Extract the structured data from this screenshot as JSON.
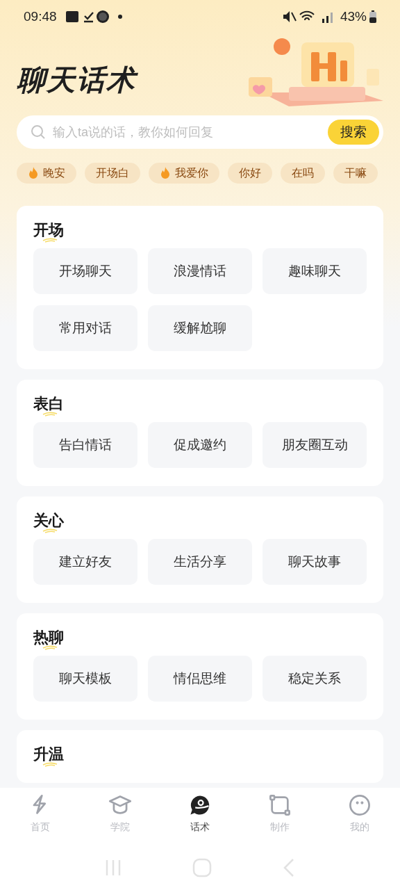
{
  "status_bar": {
    "time": "09:48",
    "battery": "43%"
  },
  "title": "聊天话术",
  "search": {
    "placeholder": "输入ta说的话，教你如何回复",
    "button": "搜索"
  },
  "chips": [
    {
      "label": "晚安",
      "hot": true
    },
    {
      "label": "开场白",
      "hot": false
    },
    {
      "label": "我爱你",
      "hot": true
    },
    {
      "label": "你好",
      "hot": false
    },
    {
      "label": "在吗",
      "hot": false
    },
    {
      "label": "干嘛",
      "hot": false
    }
  ],
  "sections": [
    {
      "title": "开场",
      "items": [
        "开场聊天",
        "浪漫情话",
        "趣味聊天",
        "常用对话",
        "缓解尬聊"
      ]
    },
    {
      "title": "表白",
      "items": [
        "告白情话",
        "促成邀约",
        "朋友圈互动"
      ]
    },
    {
      "title": "关心",
      "items": [
        "建立好友",
        "生活分享",
        "聊天故事"
      ]
    },
    {
      "title": "热聊",
      "items": [
        "聊天模板",
        "情侣思维",
        "稳定关系"
      ]
    },
    {
      "title": "升温"
    }
  ],
  "bottom_nav": [
    {
      "label": "首页",
      "selected": false
    },
    {
      "label": "学院",
      "selected": false
    },
    {
      "label": "话术",
      "selected": true
    },
    {
      "label": "制作",
      "selected": false
    },
    {
      "label": "我的",
      "selected": false
    }
  ]
}
